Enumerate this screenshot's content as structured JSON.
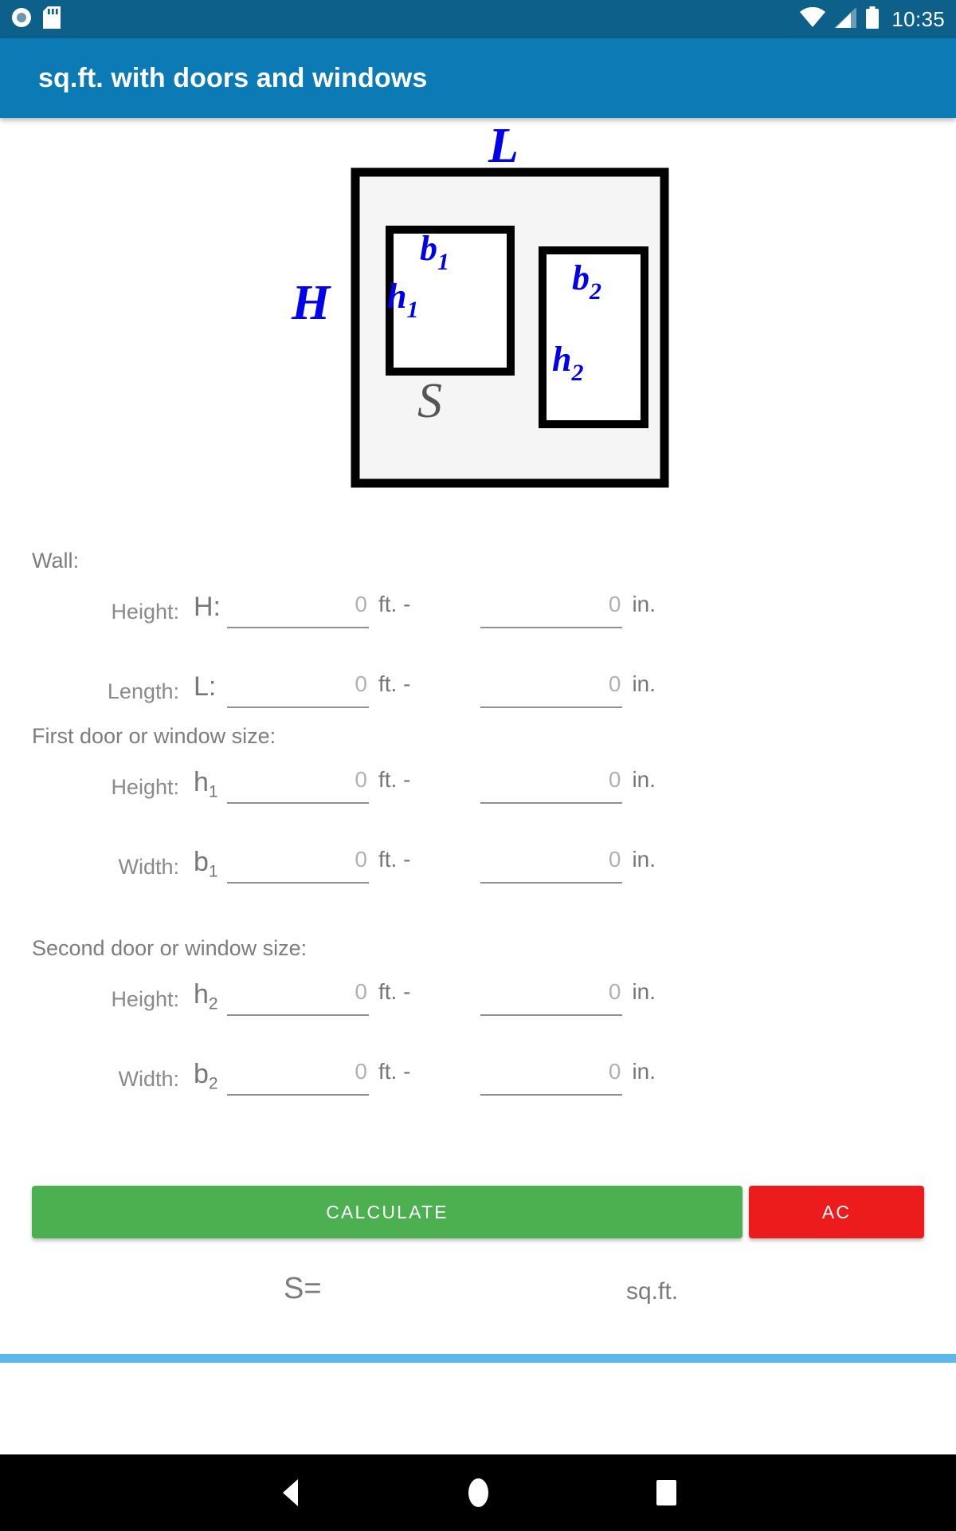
{
  "status_bar": {
    "icons": [
      "record-icon",
      "sd-card-icon",
      "wifi-icon",
      "cellular-signal-icon",
      "battery-icon"
    ],
    "time": "10:35",
    "background_color": "#0d6089"
  },
  "app_bar": {
    "title": "sq.ft. with doors and windows",
    "background_color": "#0b7ab5"
  },
  "diagram": {
    "labels": {
      "length": "L",
      "height": "H",
      "area": "S",
      "first_width": "b",
      "first_width_sub": "1",
      "first_height": "h",
      "first_height_sub": "1",
      "second_width": "b",
      "second_width_sub": "2",
      "second_height": "h",
      "second_height_sub": "2"
    },
    "label_color": "#0000ee",
    "area_label_color": "#555555",
    "wall_fill": "#f5f5f5",
    "opening_fill": "#ffffff",
    "stroke_color": "#000000"
  },
  "form": {
    "sections": {
      "wall": "Wall:",
      "first": "First door or window size:",
      "second": "Second door or window size:"
    },
    "units": {
      "feet": "ft. -",
      "inches": "in."
    },
    "rows": [
      {
        "name": "Height:",
        "symbol": "H",
        "sub": "",
        "colon": ":",
        "ft_value": "0",
        "in_value": "0"
      },
      {
        "name": "Length:",
        "symbol": "L",
        "sub": "",
        "colon": ":",
        "ft_value": "0",
        "in_value": "0"
      },
      {
        "name": "Height:",
        "symbol": "h",
        "sub": "1",
        "colon": "",
        "ft_value": "0",
        "in_value": "0"
      },
      {
        "name": "Width:",
        "symbol": "b",
        "sub": "1",
        "colon": "",
        "ft_value": "0",
        "in_value": "0"
      },
      {
        "name": "Height:",
        "symbol": "h",
        "sub": "2",
        "colon": "",
        "ft_value": "0",
        "in_value": "0"
      },
      {
        "name": "Width:",
        "symbol": "b",
        "sub": "2",
        "colon": "",
        "ft_value": "0",
        "in_value": "0"
      }
    ]
  },
  "buttons": {
    "calculate": "CALCULATE",
    "clear": "AC",
    "calculate_color": "#4caf50",
    "clear_color": "#ec1c1c"
  },
  "result": {
    "label": "S=",
    "value": "",
    "unit": "sq.ft."
  },
  "divider": {
    "color": "#5bb8ec"
  },
  "nav_bar": {
    "back": "back-icon",
    "home": "home-icon",
    "recents": "recents-icon"
  }
}
